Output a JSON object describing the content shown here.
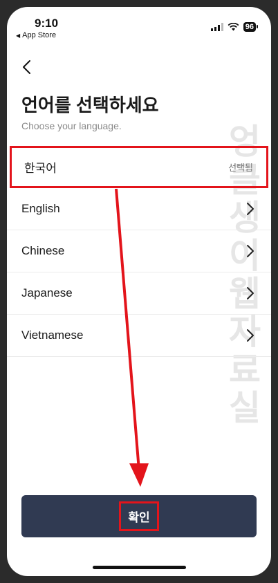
{
  "status_bar": {
    "time": "9:10",
    "back_app_label": "App Store",
    "battery": "96"
  },
  "header": {
    "title": "언어를 선택하세요",
    "subtitle": "Choose your language."
  },
  "languages": [
    {
      "label": "한국어",
      "selected": true,
      "selected_label": "선택됨"
    },
    {
      "label": "English"
    },
    {
      "label": "Chinese"
    },
    {
      "label": "Japanese"
    },
    {
      "label": "Vietnamese"
    }
  ],
  "confirm_button": {
    "label": "확인"
  },
  "watermark": [
    "엉",
    "클",
    "생",
    "이",
    "웹",
    "자",
    "료",
    "실"
  ],
  "colors": {
    "primary": "#303a52",
    "highlight": "#e3141b"
  }
}
